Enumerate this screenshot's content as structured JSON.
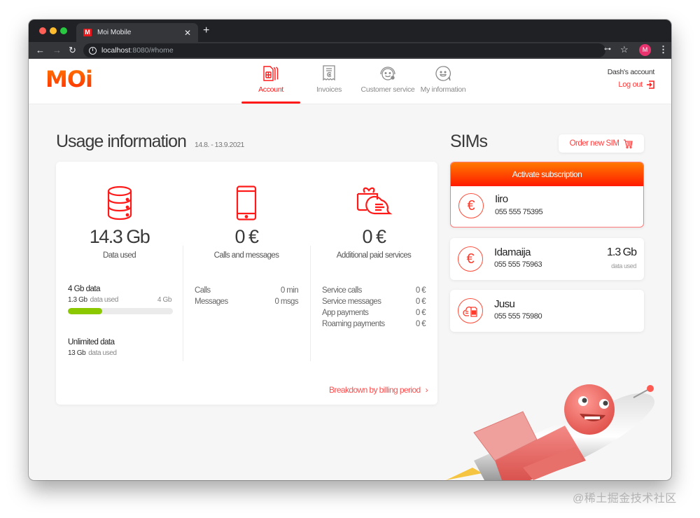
{
  "browser": {
    "tab_title": "Moi Mobile",
    "favicon_text": "M",
    "url_host": "localhost",
    "url_rest": ":8080/#home",
    "profile_initial": "M"
  },
  "header": {
    "logo": "MOi",
    "nav": [
      {
        "label": "Account",
        "icon": "sim-cards-icon",
        "active": true
      },
      {
        "label": "Invoices",
        "icon": "receipt-icon",
        "active": false
      },
      {
        "label": "Customer service",
        "icon": "headset-smiley-icon",
        "active": false
      },
      {
        "label": "My information",
        "icon": "smiley-bubble-icon",
        "active": false
      }
    ],
    "account_name": "Dash's account",
    "logout_label": "Log out"
  },
  "usage": {
    "title": "Usage information",
    "date_range": "14.8. - 13.9.2021",
    "columns": [
      {
        "icon": "database-icon",
        "value": "14.3 Gb",
        "label": "Data used"
      },
      {
        "icon": "phone-icon",
        "value": "0 €",
        "label": "Calls and messages"
      },
      {
        "icon": "gift-chat-icon",
        "value": "0 €",
        "label": "Additional paid services"
      }
    ],
    "plans": [
      {
        "name": "4 Gb data",
        "used": "1.3 Gb",
        "used_suffix": "data used",
        "limit": "4 Gb",
        "progress": 0.325
      },
      {
        "name": "Unlimited data",
        "used": "13 Gb",
        "used_suffix": "data used"
      }
    ],
    "calls": [
      {
        "label": "Calls",
        "value": "0 min"
      },
      {
        "label": "Messages",
        "value": "0 msgs"
      }
    ],
    "services": [
      {
        "label": "Service calls",
        "value": "0 €"
      },
      {
        "label": "Service messages",
        "value": "0 €"
      },
      {
        "label": "App payments",
        "value": "0 €"
      },
      {
        "label": "Roaming payments",
        "value": "0 €"
      }
    ],
    "breakdown_link": "Breakdown by billing period",
    "breakdown_chevron": "›"
  },
  "sims": {
    "title": "SIMs",
    "order_button": "Order new SIM",
    "activate_label": "Activate subscription",
    "cards": [
      {
        "name": "Iiro",
        "number": "055 555 75395",
        "icon": "euro-icon",
        "glyph": "€"
      },
      {
        "name": "Idamaija",
        "number": "055 555 75963",
        "icon": "euro-icon",
        "glyph": "€",
        "data": "1.3 Gb",
        "data_label": "data used"
      },
      {
        "name": "Jusu",
        "number": "055 555 75980",
        "icon": "cloud-sim-icon"
      }
    ]
  },
  "colors": {
    "brand_red": "#ff1a1a",
    "brand_orange": "#ff7a00",
    "progress_green": "#8cc800"
  },
  "watermark": "@稀土掘金技术社区"
}
